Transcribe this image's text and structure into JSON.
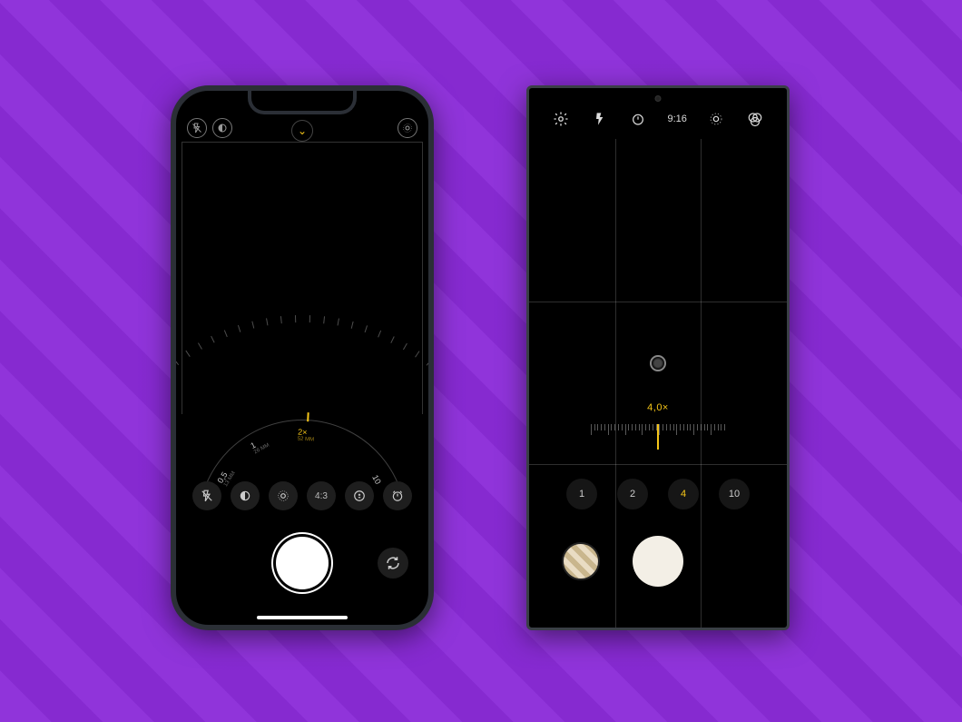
{
  "iphone": {
    "chevron": "⌄",
    "arc": {
      "stops": [
        {
          "label": "0,5",
          "sub": "13 MM",
          "angle": -58
        },
        {
          "label": "1",
          "sub": "26 MM",
          "angle": -28
        },
        {
          "label": "2×",
          "sub": "52 MM",
          "angle": 3,
          "selected": true
        },
        {
          "label": "10",
          "sub": "",
          "angle": 62
        }
      ]
    },
    "tools": {
      "flash": "✕",
      "night": "◐",
      "live": "◎",
      "ratio": "4:3",
      "exposure": "±",
      "timer": "⟳"
    },
    "switch": "⟲"
  },
  "android": {
    "ratio_label": "9:16",
    "zoom_value": "4,0×",
    "presets": [
      "1",
      "2",
      "4",
      "10"
    ],
    "preset_selected": "4"
  }
}
